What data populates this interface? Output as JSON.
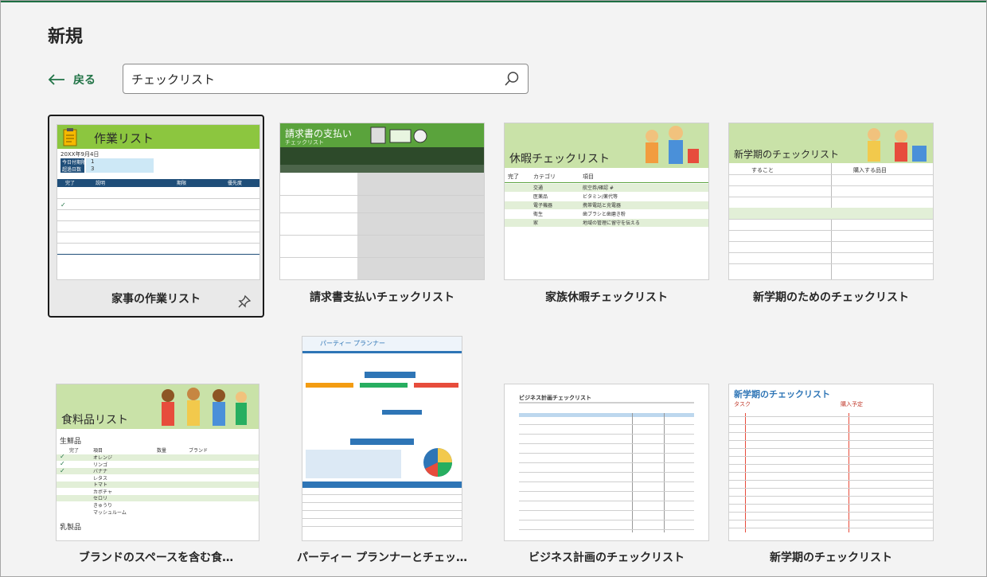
{
  "page": {
    "heading": "新規"
  },
  "nav": {
    "back_label": "戻る"
  },
  "search": {
    "value": "チェックリスト"
  },
  "templates": [
    {
      "label": "家事の作業リスト",
      "thumb_title": "作業リスト",
      "date": "20XX年9月4日",
      "kv": [
        [
          "今日付期限",
          "1"
        ],
        [
          "超過日数",
          "3"
        ]
      ],
      "cols": [
        "完了",
        "説明",
        "期限",
        "優先度"
      ]
    },
    {
      "label": "請求書支払いチェックリスト",
      "thumb_title": "請求書の支払い",
      "thumb_sub": "チェックリスト"
    },
    {
      "label": "家族休暇チェックリスト",
      "thumb_title": "休暇チェックリスト",
      "cols": [
        "完了",
        "カテゴリ",
        "項目"
      ],
      "rows": [
        [
          "交通",
          "航空券/確認 #"
        ],
        [
          "医薬品",
          "ビタミン/薬代等"
        ],
        [
          "電子機器",
          "携帯電話と充電器"
        ],
        [
          "衛生",
          "歯ブラシと歯磨き粉"
        ],
        [
          "家",
          "地域の管理に留守を伝える"
        ]
      ]
    },
    {
      "label": "新学期のためのチェックリスト",
      "thumb_title": "新学期のチェックリスト",
      "col_left": "すること",
      "col_right": "購入する品目"
    },
    {
      "label": "ブランドのスペースを含む食…",
      "thumb_title": "食料品リスト",
      "section1": "生鮮品",
      "section2": "乳製品",
      "items": [
        "オレンジ",
        "リンゴ",
        "バナナ",
        "レタス",
        "トマト",
        "カボチャ",
        "セロリ",
        "きゅうり",
        "マッシュルーム"
      ],
      "cols": [
        "完了",
        "項目",
        "数量",
        "ブランド"
      ]
    },
    {
      "label": "パーティー プランナーとチェッ…",
      "thumb_title": "パーティー プランナー"
    },
    {
      "label": "ビジネス計画のチェックリスト",
      "thumb_title": "ビジネス計画チェックリスト"
    },
    {
      "label": "新学期のチェックリスト",
      "thumb_title": "新学期のチェックリスト",
      "col_left": "タスク",
      "col_right": "購入予定"
    }
  ]
}
